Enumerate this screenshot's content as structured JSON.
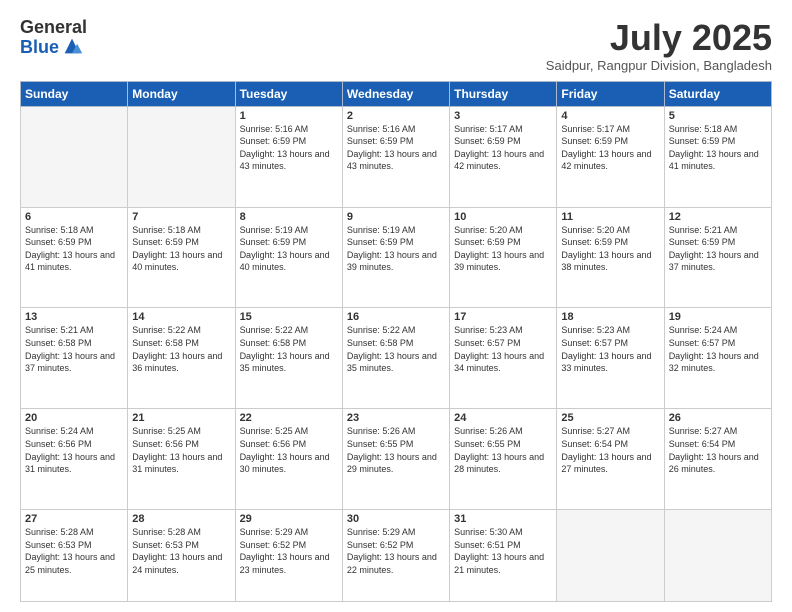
{
  "logo": {
    "general": "General",
    "blue": "Blue"
  },
  "title": "July 2025",
  "subtitle": "Saidpur, Rangpur Division, Bangladesh",
  "weekdays": [
    "Sunday",
    "Monday",
    "Tuesday",
    "Wednesday",
    "Thursday",
    "Friday",
    "Saturday"
  ],
  "weeks": [
    [
      {
        "day": "",
        "info": ""
      },
      {
        "day": "",
        "info": ""
      },
      {
        "day": "1",
        "info": "Sunrise: 5:16 AM\nSunset: 6:59 PM\nDaylight: 13 hours and 43 minutes."
      },
      {
        "day": "2",
        "info": "Sunrise: 5:16 AM\nSunset: 6:59 PM\nDaylight: 13 hours and 43 minutes."
      },
      {
        "day": "3",
        "info": "Sunrise: 5:17 AM\nSunset: 6:59 PM\nDaylight: 13 hours and 42 minutes."
      },
      {
        "day": "4",
        "info": "Sunrise: 5:17 AM\nSunset: 6:59 PM\nDaylight: 13 hours and 42 minutes."
      },
      {
        "day": "5",
        "info": "Sunrise: 5:18 AM\nSunset: 6:59 PM\nDaylight: 13 hours and 41 minutes."
      }
    ],
    [
      {
        "day": "6",
        "info": "Sunrise: 5:18 AM\nSunset: 6:59 PM\nDaylight: 13 hours and 41 minutes."
      },
      {
        "day": "7",
        "info": "Sunrise: 5:18 AM\nSunset: 6:59 PM\nDaylight: 13 hours and 40 minutes."
      },
      {
        "day": "8",
        "info": "Sunrise: 5:19 AM\nSunset: 6:59 PM\nDaylight: 13 hours and 40 minutes."
      },
      {
        "day": "9",
        "info": "Sunrise: 5:19 AM\nSunset: 6:59 PM\nDaylight: 13 hours and 39 minutes."
      },
      {
        "day": "10",
        "info": "Sunrise: 5:20 AM\nSunset: 6:59 PM\nDaylight: 13 hours and 39 minutes."
      },
      {
        "day": "11",
        "info": "Sunrise: 5:20 AM\nSunset: 6:59 PM\nDaylight: 13 hours and 38 minutes."
      },
      {
        "day": "12",
        "info": "Sunrise: 5:21 AM\nSunset: 6:59 PM\nDaylight: 13 hours and 37 minutes."
      }
    ],
    [
      {
        "day": "13",
        "info": "Sunrise: 5:21 AM\nSunset: 6:58 PM\nDaylight: 13 hours and 37 minutes."
      },
      {
        "day": "14",
        "info": "Sunrise: 5:22 AM\nSunset: 6:58 PM\nDaylight: 13 hours and 36 minutes."
      },
      {
        "day": "15",
        "info": "Sunrise: 5:22 AM\nSunset: 6:58 PM\nDaylight: 13 hours and 35 minutes."
      },
      {
        "day": "16",
        "info": "Sunrise: 5:22 AM\nSunset: 6:58 PM\nDaylight: 13 hours and 35 minutes."
      },
      {
        "day": "17",
        "info": "Sunrise: 5:23 AM\nSunset: 6:57 PM\nDaylight: 13 hours and 34 minutes."
      },
      {
        "day": "18",
        "info": "Sunrise: 5:23 AM\nSunset: 6:57 PM\nDaylight: 13 hours and 33 minutes."
      },
      {
        "day": "19",
        "info": "Sunrise: 5:24 AM\nSunset: 6:57 PM\nDaylight: 13 hours and 32 minutes."
      }
    ],
    [
      {
        "day": "20",
        "info": "Sunrise: 5:24 AM\nSunset: 6:56 PM\nDaylight: 13 hours and 31 minutes."
      },
      {
        "day": "21",
        "info": "Sunrise: 5:25 AM\nSunset: 6:56 PM\nDaylight: 13 hours and 31 minutes."
      },
      {
        "day": "22",
        "info": "Sunrise: 5:25 AM\nSunset: 6:56 PM\nDaylight: 13 hours and 30 minutes."
      },
      {
        "day": "23",
        "info": "Sunrise: 5:26 AM\nSunset: 6:55 PM\nDaylight: 13 hours and 29 minutes."
      },
      {
        "day": "24",
        "info": "Sunrise: 5:26 AM\nSunset: 6:55 PM\nDaylight: 13 hours and 28 minutes."
      },
      {
        "day": "25",
        "info": "Sunrise: 5:27 AM\nSunset: 6:54 PM\nDaylight: 13 hours and 27 minutes."
      },
      {
        "day": "26",
        "info": "Sunrise: 5:27 AM\nSunset: 6:54 PM\nDaylight: 13 hours and 26 minutes."
      }
    ],
    [
      {
        "day": "27",
        "info": "Sunrise: 5:28 AM\nSunset: 6:53 PM\nDaylight: 13 hours and 25 minutes."
      },
      {
        "day": "28",
        "info": "Sunrise: 5:28 AM\nSunset: 6:53 PM\nDaylight: 13 hours and 24 minutes."
      },
      {
        "day": "29",
        "info": "Sunrise: 5:29 AM\nSunset: 6:52 PM\nDaylight: 13 hours and 23 minutes."
      },
      {
        "day": "30",
        "info": "Sunrise: 5:29 AM\nSunset: 6:52 PM\nDaylight: 13 hours and 22 minutes."
      },
      {
        "day": "31",
        "info": "Sunrise: 5:30 AM\nSunset: 6:51 PM\nDaylight: 13 hours and 21 minutes."
      },
      {
        "day": "",
        "info": ""
      },
      {
        "day": "",
        "info": ""
      }
    ]
  ]
}
